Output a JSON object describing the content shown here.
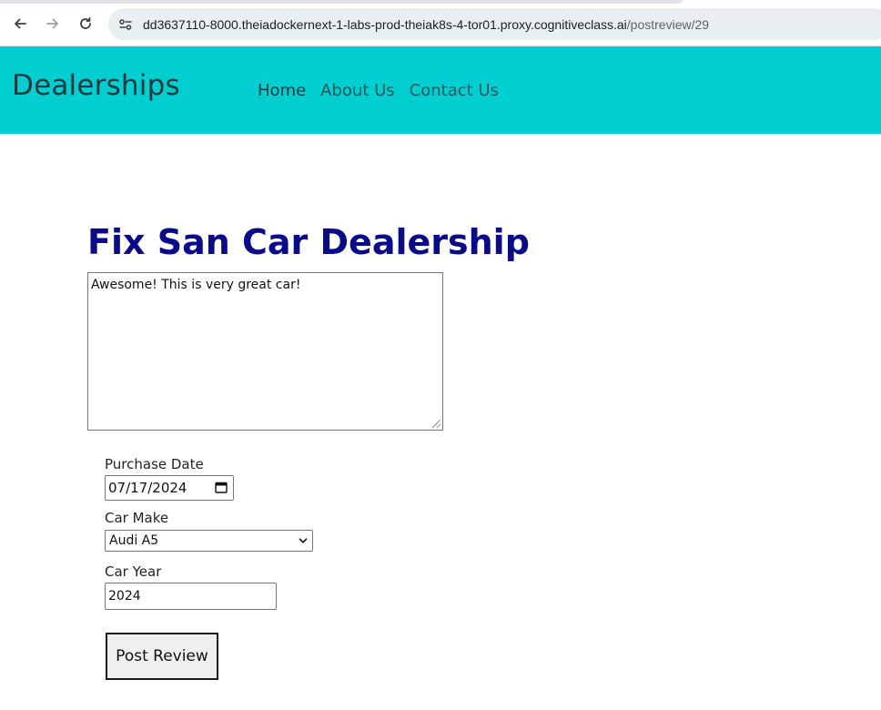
{
  "browser": {
    "url_host": "dd3637110-8000.theiadockernext-1-labs-prod-theiak8s-4-tor01.proxy.cognitiveclass.ai",
    "url_path": "/postreview/29"
  },
  "navbar": {
    "brand": "Dealerships",
    "links": [
      {
        "label": "Home",
        "active": true
      },
      {
        "label": "About Us",
        "active": false
      },
      {
        "label": "Contact Us",
        "active": false
      }
    ],
    "background_color": "#00ced1"
  },
  "review_form": {
    "dealer_name": "Fix San Car Dealership",
    "review_text": "Awesome! This is very great car!",
    "purchase_date_label": "Purchase Date",
    "purchase_date_value": "07/17/2024",
    "car_make_label": "Car Make",
    "car_make_selected": "Audi A5",
    "car_year_label": "Car Year",
    "car_year_value": "2024",
    "submit_label": "Post Review",
    "title_color": "#0b0b8a"
  },
  "icons": {
    "back": "arrow-left-icon",
    "forward": "arrow-right-icon",
    "reload": "reload-icon",
    "site_info": "site-settings-icon",
    "calendar": "calendar-icon",
    "dropdown": "chevron-down-icon"
  }
}
